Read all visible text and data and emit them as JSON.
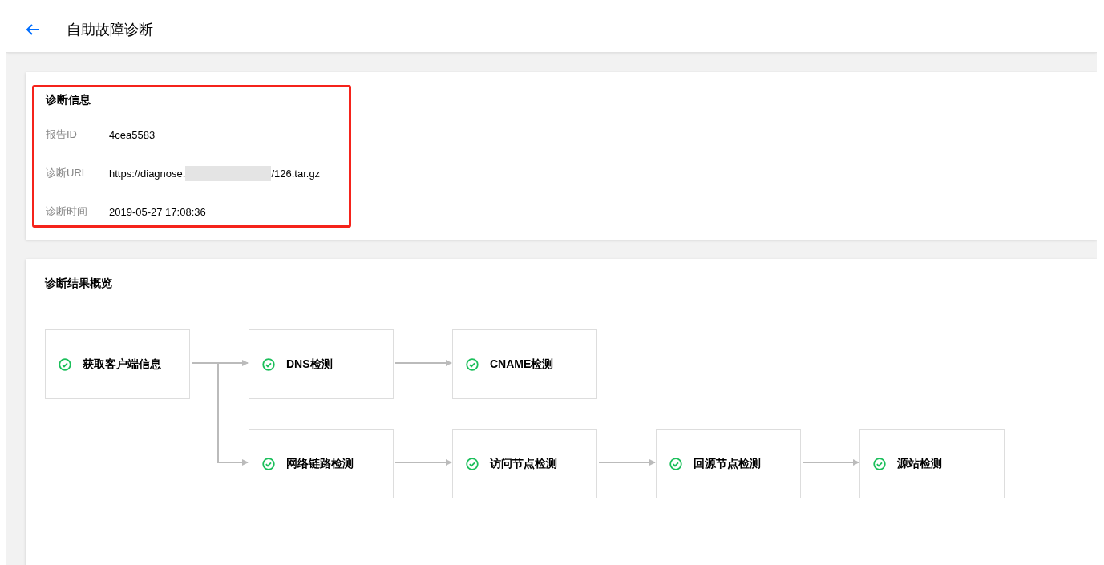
{
  "header": {
    "title": "自助故障诊断"
  },
  "info": {
    "title": "诊断信息",
    "highlighted": true,
    "fields": [
      {
        "kind": "text",
        "label": "报告ID",
        "value": "4cea5583"
      },
      {
        "kind": "url",
        "label": "诊断URL",
        "before": "https://diagnose.",
        "after": "/126.tar.gz",
        "redacted": true
      },
      {
        "kind": "text",
        "label": "诊断时间",
        "value": "2019-05-27 17:08:36"
      }
    ]
  },
  "overview": {
    "title": "诊断结果概览",
    "flow": {
      "label": "获取客户端信息",
      "passed": true,
      "children": [
        {
          "label": "DNS检测",
          "passed": true,
          "children": [
            {
              "label": "CNAME检测",
              "passed": true
            }
          ]
        },
        {
          "label": "网络链路检测",
          "passed": true,
          "children": [
            {
              "label": "访问节点检测",
              "passed": true,
              "children": [
                {
                  "label": "回源节点检测",
                  "passed": true,
                  "children": [
                    {
                      "label": "源站检测",
                      "passed": true
                    }
                  ]
                }
              ]
            }
          ]
        }
      ]
    }
  }
}
